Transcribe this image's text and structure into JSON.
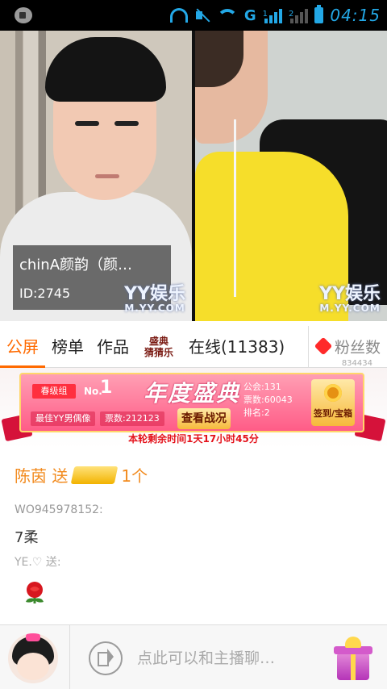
{
  "status_bar": {
    "time": "04:15",
    "network": "G",
    "sim1": "1",
    "sim2": "2"
  },
  "video": {
    "anchor_name": "chinA颜韵（颜…",
    "anchor_id": "ID:2745",
    "watermark_main": "YY娱乐",
    "watermark_sub": "M.YY.COM"
  },
  "tabs": {
    "items": [
      "公屏",
      "榜单",
      "作品"
    ],
    "event_badge_top": "盛典",
    "event_badge_bottom": "猜猜乐",
    "online": "在线(11383)",
    "fans_label": "粉丝数",
    "fans_count": "834434"
  },
  "banner": {
    "rank_label": "春级组",
    "no_label": "No.",
    "no_value": "1",
    "title": "年度盛典",
    "best": "最佳YY男偶像",
    "votes": "票数:212123",
    "view_button": "查看战况",
    "guild": "公会:131",
    "total_votes": "票数:60043",
    "rank": "排名:2",
    "checkin": "签到/宝箱",
    "countdown": "本轮剩余时间1天17小时45分"
  },
  "chat": {
    "gift_sender": "陈茵 送",
    "gift_count": "1个",
    "user1": "WO945978152:",
    "message1": "7柔",
    "system_line": "YE.♡ 送:"
  },
  "bottom": {
    "input_placeholder": "点此可以和主播聊…"
  }
}
